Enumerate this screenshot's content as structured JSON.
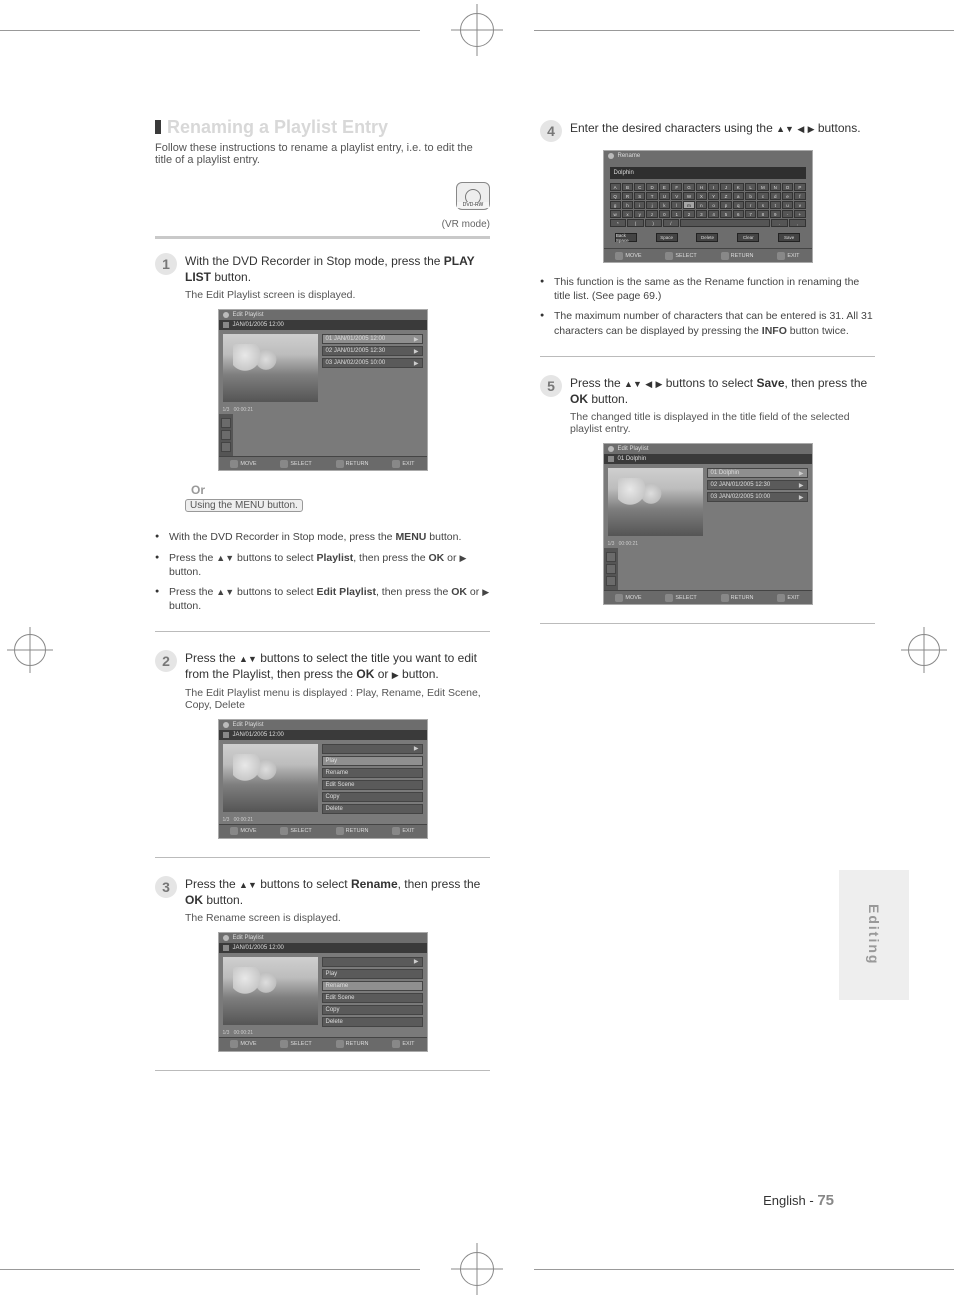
{
  "crop": {
    "present": true
  },
  "section_title": "Renaming a Playlist Entry",
  "intro": "Follow these instructions to rename a playlist entry, i.e. to edit the title of a playlist entry.",
  "disc_icon_label": "DVD-RW",
  "mode_caption": "(VR mode)",
  "steps": {
    "s1": {
      "num": "1",
      "text_a": "With the DVD Recorder in Stop mode, press the ",
      "text_bold": "PLAY LIST",
      "text_b": " button.",
      "sub": "The Edit Playlist screen is displayed.",
      "using_label": "Using the MENU button.",
      "bullets": {
        "b1a": "With the DVD Recorder in Stop mode, press the ",
        "b1bold": "MENU",
        "b1b": " button.",
        "b2a": "Press the ",
        "b2b": " buttons to select ",
        "b2bold": "Playlist",
        "b2c": ", then press the ",
        "b2bold2": "OK",
        "b2d": " or ",
        "b2e": " button.",
        "b3a": "Press the ",
        "b3b": " buttons to select ",
        "b3bold": "Edit Playlist",
        "b3c": ", then press the ",
        "b3bold2": "OK",
        "b3d": " or ",
        "b3e": " button."
      }
    },
    "s2": {
      "num": "2",
      "text_a": "Press the ",
      "text_b": " buttons to select the title you want to edit from the Playlist, then press the ",
      "text_bold": "OK",
      "text_c": " or ",
      "text_d": " button.",
      "sub": "The Edit Playlist menu is displayed : Play, Rename, Edit Scene, Copy, Delete"
    },
    "s3": {
      "num": "3",
      "text_a": "Press the ",
      "text_b": " buttons to select ",
      "text_bold": "Rename",
      "text_c": ", then press the ",
      "text_bold2": "OK",
      "text_d": " button.",
      "sub": "The Rename screen is displayed."
    },
    "s4": {
      "num": "4",
      "text_a": "Enter the desired characters using the ",
      "text_b": " buttons.",
      "bullets": {
        "b1": "This function is the same as the Rename function in renaming the title list. (See page 69.)",
        "b2a": "The maximum number of characters that can be entered is 31. All 31 characters can be displayed by pressing the ",
        "b2bold": "INFO",
        "b2b": " button twice."
      }
    },
    "s5": {
      "num": "5",
      "text_a": "Press the ",
      "text_b": " buttons to select ",
      "text_bold": "Save",
      "text_c": ", then press the ",
      "text_bold2": "OK",
      "text_d": " button.",
      "sub": "The changed title is displayed in the title field of the selected playlist entry."
    }
  },
  "screenshots": {
    "common_footer": {
      "move": "MOVE",
      "select": "SELECT",
      "return": "RETURN",
      "exit": "EXIT"
    },
    "editplaylist": {
      "title": "Edit Playlist",
      "rows": {
        "date": "JAN/01/2005 12:00",
        "info": "1/3",
        "len": "00:00:21",
        "r1": "01 JAN/01/2005 12:00",
        "r2": "02 JAN/01/2005 12:30",
        "r3": "03 JAN/02/2005 10:00"
      }
    },
    "playlistmenu": {
      "rows": {
        "m1": "Play",
        "m2": "Rename",
        "m3": "Edit Scene",
        "m4": "Copy",
        "m5": "Delete"
      }
    },
    "rename": {
      "title": "Rename",
      "name": "Dolphin",
      "btns": {
        "b1": "Back Space",
        "b2": "Space",
        "b3": "Delete",
        "b4": "Clear",
        "b5": "Save"
      }
    },
    "final": {
      "rows": {
        "r1": "01 Dolphin",
        "r2": "02 JAN/01/2005 12:30",
        "r3": "03 JAN/02/2005 10:00"
      }
    }
  },
  "side_tab": "Editing",
  "footer": {
    "lang": "English -",
    "page": "75"
  },
  "or_label": "Or"
}
